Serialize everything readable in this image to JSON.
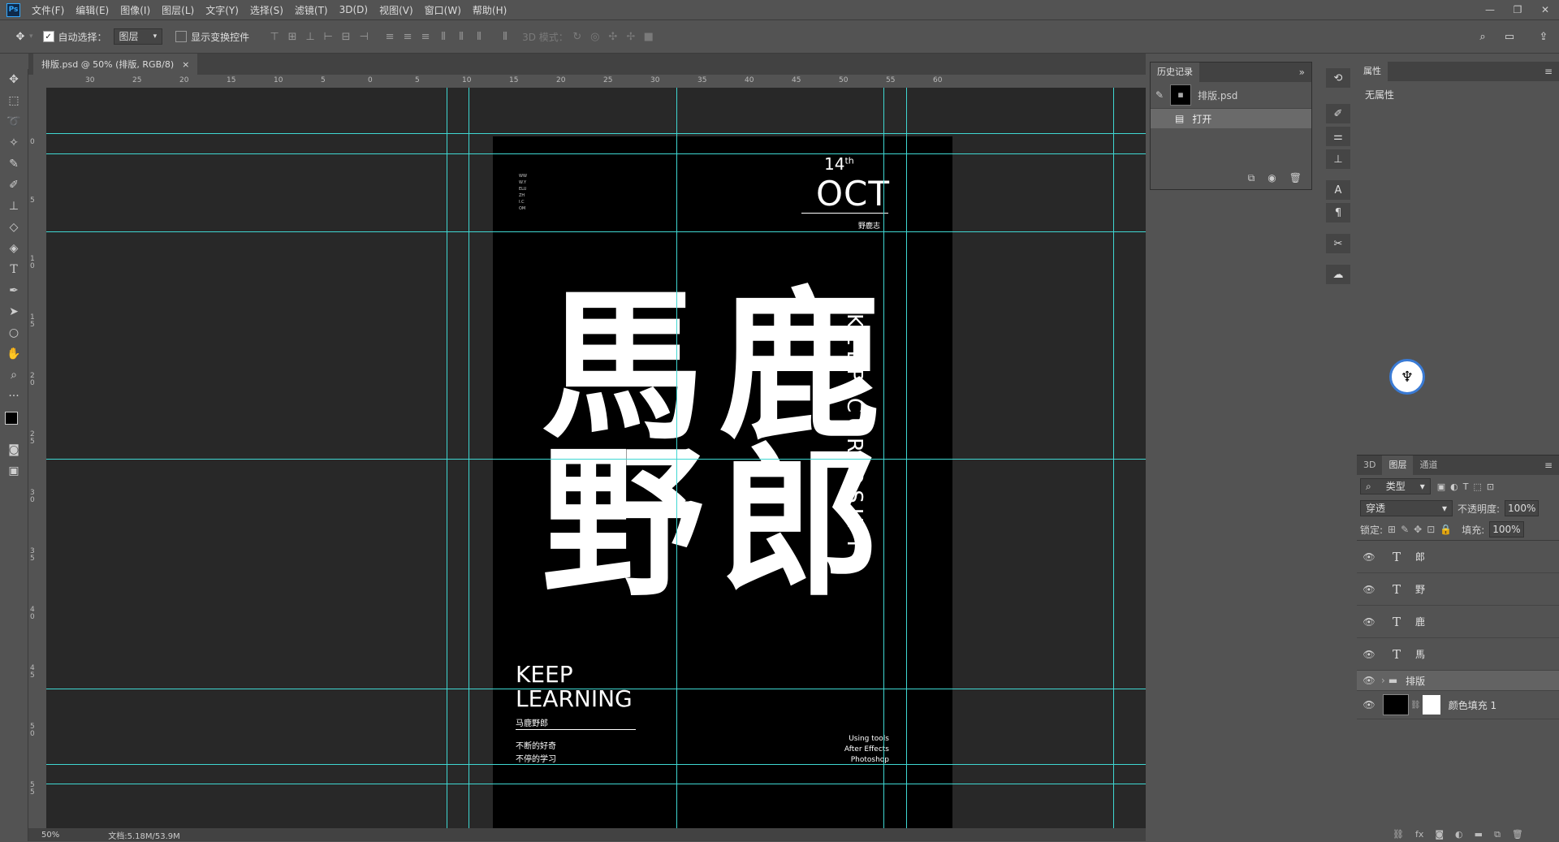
{
  "menu": {
    "items": [
      "文件(F)",
      "编辑(E)",
      "图像(I)",
      "图层(L)",
      "文字(Y)",
      "选择(S)",
      "滤镜(T)",
      "3D(D)",
      "视图(V)",
      "窗口(W)",
      "帮助(H)"
    ]
  },
  "options": {
    "auto_select_label": "自动选择：",
    "auto_select_value": "图层",
    "show_transform_label": "显示变换控件",
    "mode_3d_label": "3D 模式："
  },
  "document": {
    "tab_title": "排版.psd @ 50% (排版, RGB/8)",
    "zoom": "50%",
    "doc_size": "文档:5.18M/53.9M"
  },
  "ruler": {
    "top_labels": [
      "30",
      "25",
      "20",
      "15",
      "10",
      "5",
      "0",
      "5",
      "10",
      "15",
      "20",
      "25",
      "30",
      "35",
      "40",
      "45",
      "50",
      "55",
      "60"
    ],
    "left_labels": [
      "0",
      "5",
      "1 0",
      "1 5",
      "2 0",
      "2 5",
      "3 0",
      "3 5",
      "4 0",
      "4 5",
      "5 0",
      "5 5"
    ]
  },
  "poster": {
    "vertical_url": "WWW.YELUZHI.COM",
    "day": "14",
    "day_suffix": "th",
    "month": "OCT",
    "month_sub": "野鹿志",
    "big_chars": [
      "馬",
      "鹿",
      "野",
      "郎"
    ],
    "side_text": "KEEP CURIOSITY",
    "keep": "KEEP",
    "learning": "LEARNING",
    "name": "马鹿野郎",
    "line1": "不断的好奇",
    "line2": "不停的学习",
    "tools": [
      "Using tools",
      "After Effects",
      "Photoshop"
    ]
  },
  "history": {
    "tab": "历史记录",
    "snapshot": "排版.psd",
    "step": "打开"
  },
  "properties": {
    "tab": "属性",
    "empty": "无属性"
  },
  "layers_panel": {
    "tabs": [
      "3D",
      "图层",
      "通道"
    ],
    "filter": "类型",
    "blend": "穿透",
    "opacity_label": "不透明度:",
    "opacity": "100%",
    "lock_label": "锁定:",
    "fill_label": "填充:",
    "fill": "100%",
    "layers": [
      {
        "name": "郎",
        "type": "text"
      },
      {
        "name": "野",
        "type": "text"
      },
      {
        "name": "鹿",
        "type": "text"
      },
      {
        "name": "馬",
        "type": "text"
      },
      {
        "name": "排版",
        "type": "group"
      },
      {
        "name": "颜色填充 1",
        "type": "fill"
      }
    ]
  }
}
